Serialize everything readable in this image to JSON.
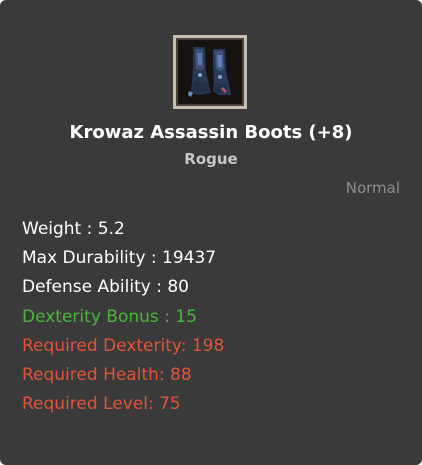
{
  "item": {
    "name": "Krowaz Assassin Boots (+8)",
    "class": "Rogue",
    "rarity": "Normal",
    "icon": "boots-icon"
  },
  "stats": {
    "weight": "Weight : 5.2",
    "max_durability": "Max Durability : 19437",
    "defense_ability": "Defense Ability : 80",
    "dexterity_bonus": "Dexterity Bonus : 15",
    "required_dexterity": "Required Dexterity: 198",
    "required_health": "Required Health: 88",
    "required_level": "Required Level: 75"
  },
  "colors": {
    "panel_bg": "#3a3a3a",
    "base_stat": "#ffffff",
    "bonus_stat": "#48b83a",
    "requirement": "#e0553a",
    "rarity": "#8f8f8f"
  }
}
